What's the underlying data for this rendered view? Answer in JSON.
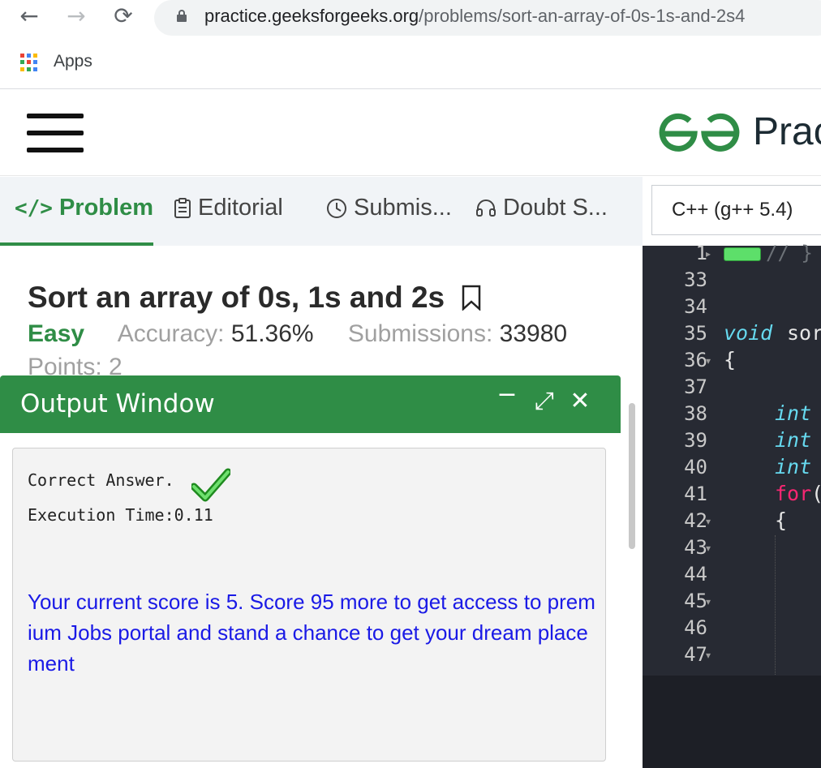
{
  "browser": {
    "url_host": "practice.geeksforgeeks.org",
    "url_path": "/problems/sort-an-array-of-0s-1s-and-2s4",
    "bookmarks_apps_label": "Apps"
  },
  "site": {
    "brand_text": "Prac"
  },
  "tabs": [
    {
      "label": "Problem",
      "icon": "code-icon"
    },
    {
      "label": "Editorial",
      "icon": "document-icon"
    },
    {
      "label": "Submis...",
      "icon": "clock-icon"
    },
    {
      "label": "Doubt S...",
      "icon": "headset-icon"
    }
  ],
  "editor": {
    "language": "C++ (g++ 5.4)",
    "line_numbers": [
      "1",
      "33",
      "34",
      "35",
      "36",
      "37",
      "38",
      "39",
      "40",
      "41",
      "42",
      "43",
      "44",
      "45",
      "46",
      "47"
    ],
    "fold_comment": "// }",
    "code": {
      "l35_kw": "void",
      "l35_fn": "sor",
      "l36": "{",
      "l38": "int",
      "l39": "int",
      "l40": "int",
      "l41_kw": "for",
      "l41_paren": "(",
      "l42": "{"
    }
  },
  "problem": {
    "title": "Sort an array of 0s, 1s and 2s",
    "difficulty": "Easy",
    "accuracy_label": "Accuracy:",
    "accuracy_value": "51.36%",
    "submissions_label": "Submissions:",
    "submissions_value": "33980",
    "points_label": "Points: 2"
  },
  "output_window": {
    "title": "Output Window",
    "result_text": "Correct Answer.",
    "execution_time": "Execution Time:0.11",
    "score_message": "Your current score is 5. Score 95 more to get access to premium Jobs portal and stand a chance to get your dream placement"
  },
  "colors": {
    "brand_green": "#2f8d46",
    "link_blue": "#1a1ae6",
    "editor_bg": "#272a33"
  }
}
